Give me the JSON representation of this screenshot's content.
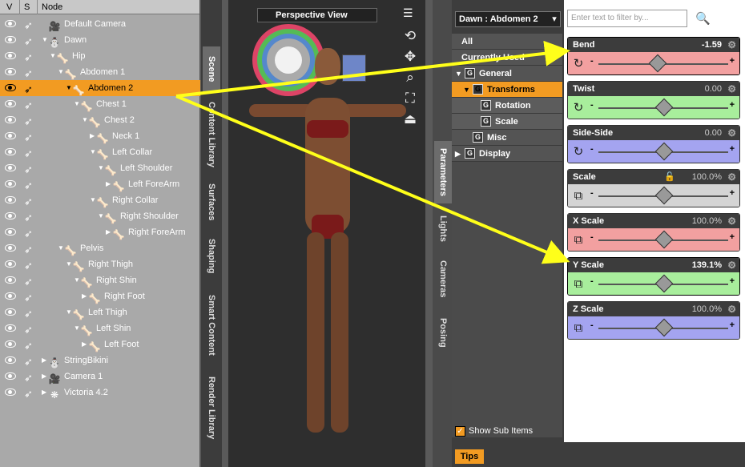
{
  "scene": {
    "col_v": "V",
    "col_s": "S",
    "col_node": "Node",
    "nodes": [
      {
        "label": "Default Camera",
        "level": 0,
        "icon": "camera-icon",
        "tw": ""
      },
      {
        "label": "Dawn",
        "level": 0,
        "icon": "figure-icon",
        "tw": "▼"
      },
      {
        "label": "Hip",
        "level": 1,
        "icon": "bone-icon",
        "tw": "▼"
      },
      {
        "label": "Abdomen 1",
        "level": 2,
        "icon": "bone-icon",
        "tw": "▼"
      },
      {
        "label": "Abdomen 2",
        "level": 3,
        "icon": "bone-icon",
        "tw": "▼",
        "selected": true
      },
      {
        "label": "Chest 1",
        "level": 4,
        "icon": "bone-icon",
        "tw": "▼"
      },
      {
        "label": "Chest 2",
        "level": 5,
        "icon": "bone-icon",
        "tw": "▼"
      },
      {
        "label": "Neck 1",
        "level": 6,
        "icon": "bone-icon",
        "tw": "▶"
      },
      {
        "label": "Left Collar",
        "level": 6,
        "icon": "bone-icon",
        "tw": "▼"
      },
      {
        "label": "Left Shoulder",
        "level": 7,
        "icon": "bone-icon",
        "tw": "▼"
      },
      {
        "label": "Left ForeArm",
        "level": 8,
        "icon": "bone-icon",
        "tw": "▶"
      },
      {
        "label": "Right Collar",
        "level": 6,
        "icon": "bone-icon",
        "tw": "▼"
      },
      {
        "label": "Right Shoulder",
        "level": 7,
        "icon": "bone-icon",
        "tw": "▼"
      },
      {
        "label": "Right ForeArm",
        "level": 8,
        "icon": "bone-icon",
        "tw": "▶"
      },
      {
        "label": "Pelvis",
        "level": 2,
        "icon": "bone-icon",
        "tw": "▼"
      },
      {
        "label": "Right Thigh",
        "level": 3,
        "icon": "bone-icon",
        "tw": "▼"
      },
      {
        "label": "Right Shin",
        "level": 4,
        "icon": "bone-icon",
        "tw": "▼"
      },
      {
        "label": "Right Foot",
        "level": 5,
        "icon": "bone-icon",
        "tw": "▶"
      },
      {
        "label": "Left Thigh",
        "level": 3,
        "icon": "bone-icon",
        "tw": "▼"
      },
      {
        "label": "Left Shin",
        "level": 4,
        "icon": "bone-icon",
        "tw": "▼"
      },
      {
        "label": "Left Foot",
        "level": 5,
        "icon": "bone-icon",
        "tw": "▶"
      },
      {
        "label": "StringBikini",
        "level": 0,
        "icon": "figure-icon",
        "tw": "▶"
      },
      {
        "label": "Camera 1",
        "level": 0,
        "icon": "camera-icon",
        "tw": "▶"
      },
      {
        "label": "Victoria 4.2",
        "level": 0,
        "icon": "group-icon",
        "tw": "▶"
      }
    ]
  },
  "left_tabs": [
    "Scene",
    "Content Library",
    "Surfaces",
    "Shaping",
    "Smart Content",
    "Render Library"
  ],
  "viewport": {
    "title": "Perspective View"
  },
  "right_tabs": [
    "Parameters",
    "Lights",
    "Cameras",
    "Posing"
  ],
  "params": {
    "node_select": "Dawn : Abdomen 2",
    "filter_placeholder": "Enter text to filter by...",
    "tree": [
      {
        "label": "All",
        "indent": 0,
        "toggle": "",
        "g": false
      },
      {
        "label": "Currently Used",
        "indent": 0,
        "toggle": "",
        "g": false
      },
      {
        "label": "General",
        "indent": 0,
        "toggle": "▼",
        "g": true
      },
      {
        "label": "Transforms",
        "indent": 1,
        "toggle": "▼",
        "g": true,
        "selected": true
      },
      {
        "label": "Rotation",
        "indent": 2,
        "toggle": "",
        "g": true
      },
      {
        "label": "Scale",
        "indent": 2,
        "toggle": "",
        "g": true
      },
      {
        "label": "Misc",
        "indent": 1,
        "toggle": "",
        "g": true
      },
      {
        "label": "Display",
        "indent": 0,
        "toggle": "▶",
        "g": true
      }
    ],
    "show_sub_items": "Show Sub Items",
    "tips": "Tips",
    "sliders": [
      {
        "name": "Bend",
        "value": "-1.59",
        "fraction": 0.45,
        "color": "#f2a0a0",
        "icon": "rotate-icon",
        "highlight": true,
        "lock": false
      },
      {
        "name": "Twist",
        "value": "0.00",
        "fraction": 0.5,
        "color": "#a8ee9c",
        "icon": "rotate-icon",
        "highlight": false,
        "lock": false
      },
      {
        "name": "Side-Side",
        "value": "0.00",
        "fraction": 0.5,
        "color": "#a4a4f0",
        "icon": "rotate-icon",
        "highlight": false,
        "lock": false
      },
      {
        "name": "Scale",
        "value": "100.0%",
        "fraction": 0.5,
        "color": "#d4d4d4",
        "icon": "scale-icon",
        "highlight": false,
        "lock": true
      },
      {
        "name": "X Scale",
        "value": "100.0%",
        "fraction": 0.5,
        "color": "#f2a0a0",
        "icon": "scale-icon",
        "highlight": false,
        "lock": false
      },
      {
        "name": "Y Scale",
        "value": "139.1%",
        "fraction": 0.5,
        "color": "#a8ee9c",
        "icon": "scale-icon",
        "highlight": true,
        "lock": false
      },
      {
        "name": "Z Scale",
        "value": "100.0%",
        "fraction": 0.5,
        "color": "#a4a4f0",
        "icon": "scale-icon",
        "highlight": false,
        "lock": false
      }
    ]
  },
  "annotation_color": "#ffff1a"
}
